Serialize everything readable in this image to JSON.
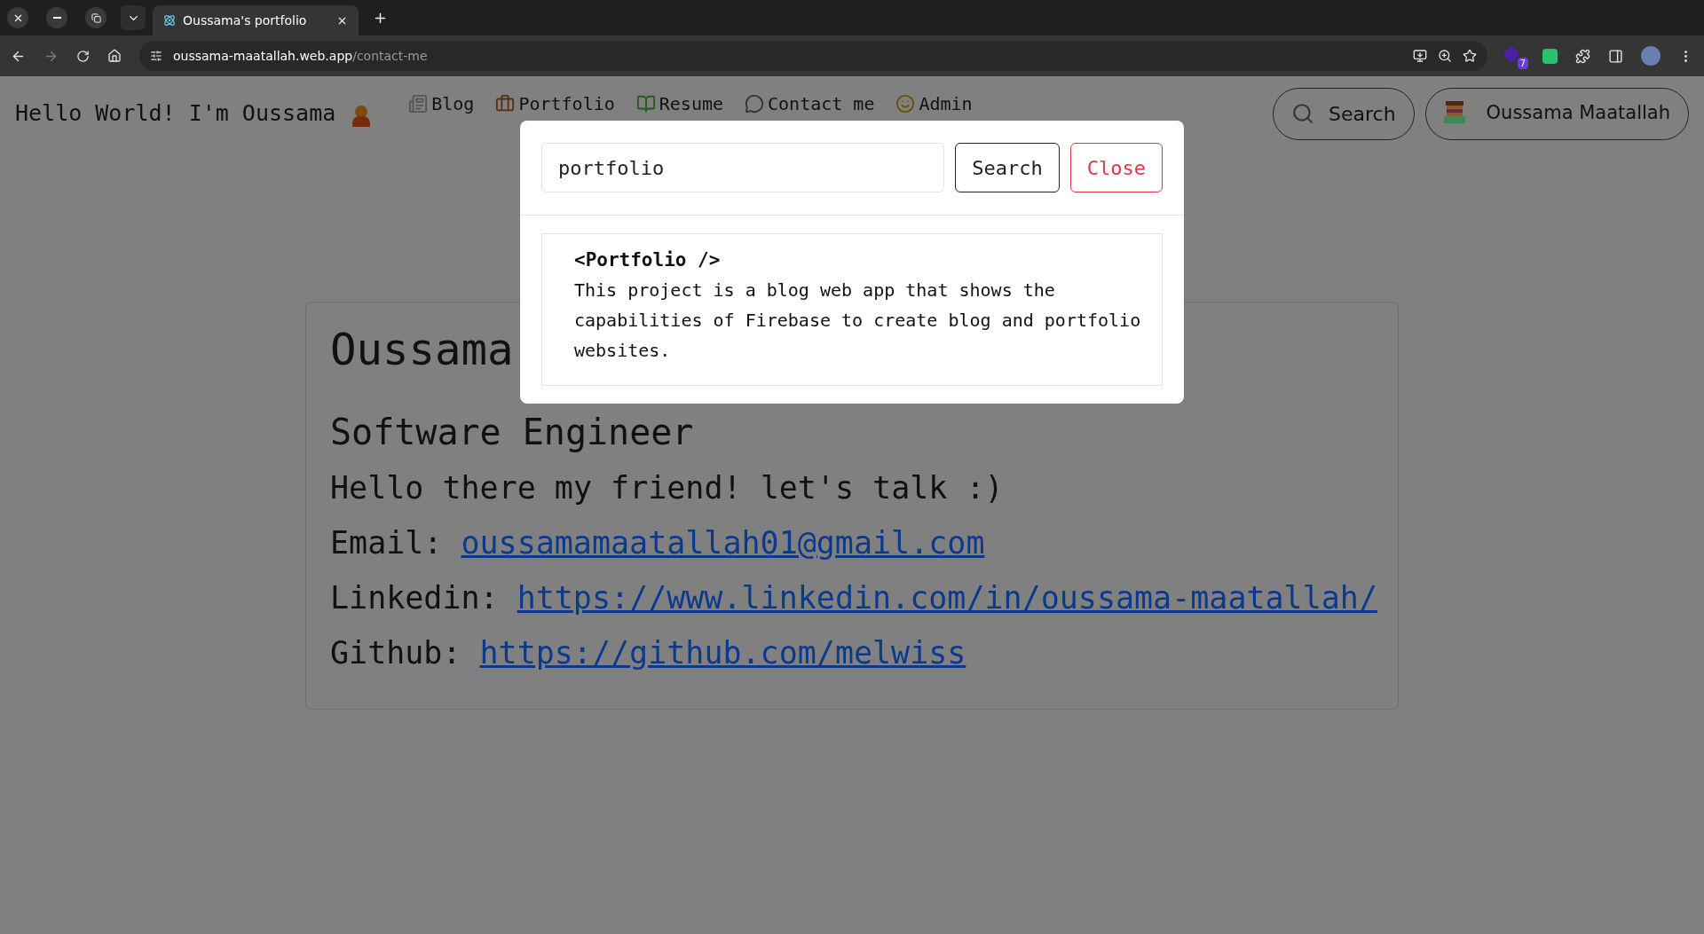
{
  "browser": {
    "tab_title": "Oussama's portfolio",
    "url_host": "oussama-maatallah.web.app",
    "url_path": "/contact-me",
    "extension_badge": "7"
  },
  "navbar": {
    "brand": "Hello World! I'm Oussama",
    "links": [
      {
        "label": "Blog",
        "kind": "newspaper"
      },
      {
        "label": "Portfolio",
        "kind": "briefcase"
      },
      {
        "label": "Resume",
        "kind": "book"
      },
      {
        "label": "Contact me",
        "kind": "chat"
      },
      {
        "label": "Admin",
        "kind": "face"
      }
    ],
    "search_button": "Search",
    "user_button": "Oussama Maatallah"
  },
  "contact_card": {
    "name": "Oussama",
    "title": "Software Engineer",
    "greeting": "Hello there my friend! let's talk :)",
    "rows": [
      {
        "label": "Email:",
        "link": "oussamamaatallah01@gmail.com"
      },
      {
        "label": "Linkedin:",
        "link": "https://www.linkedin.com/in/oussama-maatallah/"
      },
      {
        "label": "Github:",
        "link": "https://github.com/melwiss"
      }
    ]
  },
  "search_dialog": {
    "query": "portfolio",
    "search_button": "Search",
    "close_button": "Close",
    "results": [
      {
        "title": "<Portfolio />",
        "description": "This project is a blog web app that shows the capabilities of Firebase to create blog and portfolio websites."
      }
    ]
  }
}
